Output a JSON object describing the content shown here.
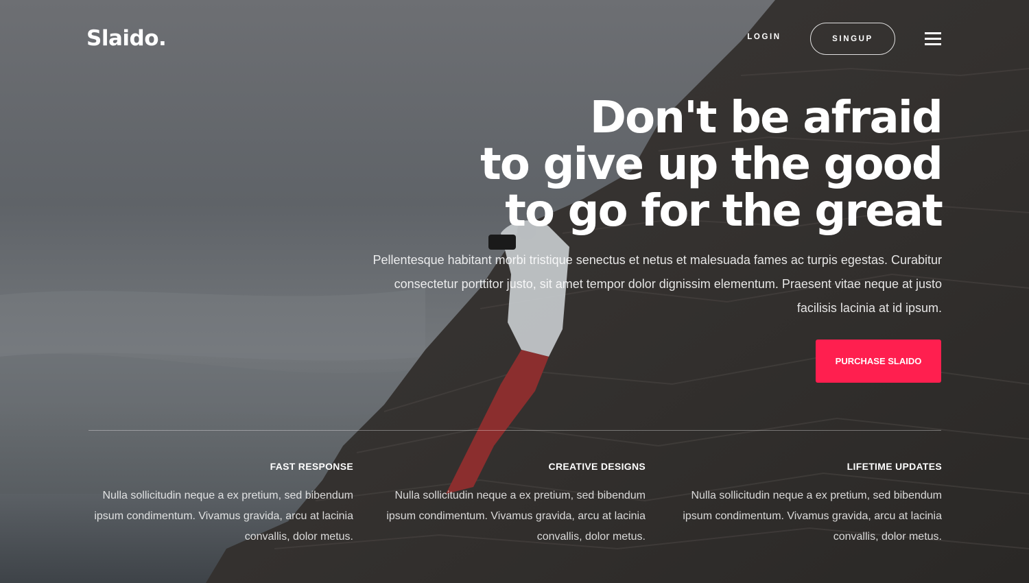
{
  "header": {
    "logo": "Slaido.",
    "login_label": "LOGIN",
    "signup_label": "SINGUP",
    "menu_icon": "hamburger-menu-icon"
  },
  "hero": {
    "headline": [
      "Don't be afraid",
      "to give up the good",
      "to go for the great"
    ],
    "lead": "Pellentesque habitant morbi tristique senectus et netus et malesuada fames ac turpis egestas. Curabitur consectetur porttitor justo, sit amet tempor dolor dignissim elementum. Praesent vitae neque at justo facilisis lacinia at id ipsum.",
    "cta_label": "PURCHASE SLAIDO"
  },
  "features": [
    {
      "title": "FAST RESPONSE",
      "text": "Nulla sollicitudin neque a ex pretium, sed bibendum ipsum condimentum. Vivamus gravida, arcu at lacinia convallis, dolor metus."
    },
    {
      "title": "CREATIVE DESIGNS",
      "text": "Nulla sollicitudin neque a ex pretium, sed bibendum ipsum condimentum. Vivamus gravida, arcu at lacinia convallis, dolor metus."
    },
    {
      "title": "LIFETIME UPDATES",
      "text": "Nulla sollicitudin neque a ex pretium, sed bibendum ipsum condimentum. Vivamus gravida, arcu at lacinia convallis, dolor metus."
    }
  ],
  "colors": {
    "accent": "#ff1f4f",
    "text": "#ffffff"
  }
}
